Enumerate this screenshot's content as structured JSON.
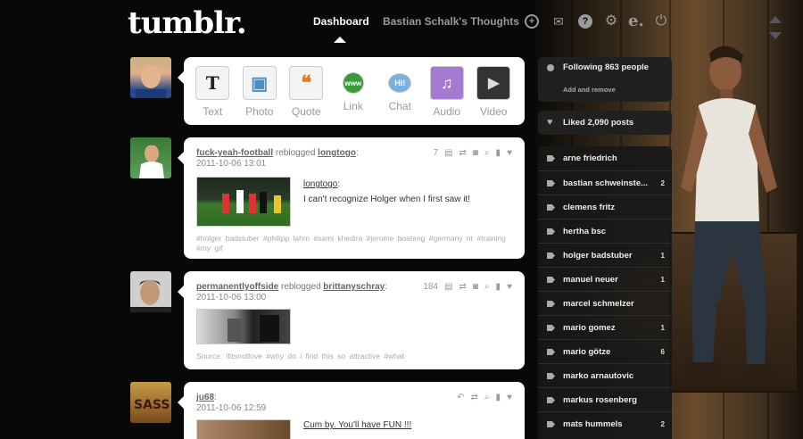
{
  "header": {
    "logo": "tumblr.",
    "nav_dashboard": "Dashboard",
    "nav_blog": "Bastian Schalk's Thoughts",
    "icons": [
      "plus-circle-icon",
      "envelope-icon",
      "help-icon",
      "gear-icon",
      "e-icon",
      "power-icon"
    ]
  },
  "post_types": [
    {
      "label": "Text",
      "glyph": "T"
    },
    {
      "label": "Photo",
      "glyph": "▣"
    },
    {
      "label": "Quote",
      "glyph": "❝"
    },
    {
      "label": "Link",
      "glyph": "www"
    },
    {
      "label": "Chat",
      "glyph": "Hi!"
    },
    {
      "label": "Audio",
      "glyph": "♫"
    },
    {
      "label": "Video",
      "glyph": "▶"
    }
  ],
  "posts": [
    {
      "user": "fuck-yeah-football",
      "reblogged_text": "reblogged",
      "source": "longtogo",
      "date": "2011-10-06 13:01",
      "count": "7",
      "caption_link": "longtogo",
      "caption": "I can't recognize Holger when I first saw it!",
      "tags": "#holger badstuber  #philipp lahm  #sami khedira  #jerome boateng  #germany nt  #training  #my gif"
    },
    {
      "user": "permanentlyoffside",
      "reblogged_text": "reblogged",
      "source": "brittanyschray",
      "date": "2011-10-06 13:00",
      "count": "184",
      "tags": "Source: ifitsnotlove  #why do i find this so attractive  #what"
    },
    {
      "user": "ju68",
      "date": "2011-10-06 12:59",
      "caption": "Cum by. You'll have FUN !!!"
    }
  ],
  "sidebar": {
    "following": "Following 863 people",
    "add_remove": "Add and remove",
    "liked": "Liked 2,090 posts",
    "tags": [
      {
        "name": "arne friedrich",
        "count": ""
      },
      {
        "name": "bastian schweinste...",
        "count": "2"
      },
      {
        "name": "clemens fritz",
        "count": ""
      },
      {
        "name": "hertha bsc",
        "count": ""
      },
      {
        "name": "holger badstuber",
        "count": "1"
      },
      {
        "name": "manuel neuer",
        "count": "1"
      },
      {
        "name": "marcel schmelzer",
        "count": ""
      },
      {
        "name": "mario gomez",
        "count": "1"
      },
      {
        "name": "mario götze",
        "count": "6"
      },
      {
        "name": "marko arnautovic",
        "count": ""
      },
      {
        "name": "markus rosenberg",
        "count": ""
      },
      {
        "name": "mats hummels",
        "count": "2"
      }
    ]
  }
}
